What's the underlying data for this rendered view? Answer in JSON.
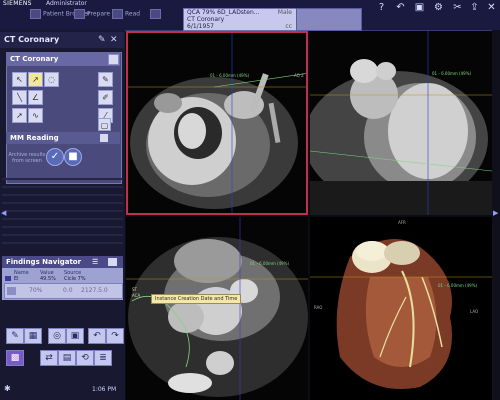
{
  "topbar": {
    "brand": "SIEMENS",
    "user": "Administrator",
    "tabs": [
      "Patient Browser",
      "Prepare",
      "Read",
      ""
    ],
    "patient": {
      "line1": "QCA 79% 6D_LADsten...",
      "sex": "Male",
      "line2": "CT Coronary",
      "line3": "6/1/1957",
      "code": "cc"
    },
    "icons": [
      "help-icon",
      "undo-icon",
      "save-icon",
      "gear-icon",
      "tools-icon",
      "send-icon",
      "close-icon"
    ]
  },
  "sidebar": {
    "title": "CT Coronary",
    "subpanel_title": "CT Coronary",
    "mm_title": "MM Reading",
    "archive_text": "Archive results from screen",
    "findings": {
      "title": "Findings Navigator",
      "columns": [
        "Name",
        "Value",
        "Source"
      ],
      "row": {
        "name": "El",
        "value": "49.5%",
        "source": "Cicle 7%"
      },
      "entry": "70%",
      "entry_value": "0.0",
      "entry_code": "2127.5.0"
    },
    "clock": "1:06 PM"
  },
  "viewports": {
    "top_left": {
      "label": "01 - 6.00mm (49%)",
      "label2": "AQ Z"
    },
    "top_right": {
      "label": "01 - 6.00mm (49%)"
    },
    "bottom_left": {
      "label": "01 - 6.00mm (49%)",
      "tooltip": "Instance Creation Date and Time",
      "tags": [
        "ST",
        "ACA"
      ]
    },
    "bottom_right": {
      "label": "01 - 6.00mm (49%)",
      "tags": [
        "AFR",
        "RAO",
        "LAO"
      ]
    }
  },
  "colors": {
    "accent": "#3a3a70",
    "selected_border": "#c0304a",
    "vessel_green": "#7fd67f"
  }
}
